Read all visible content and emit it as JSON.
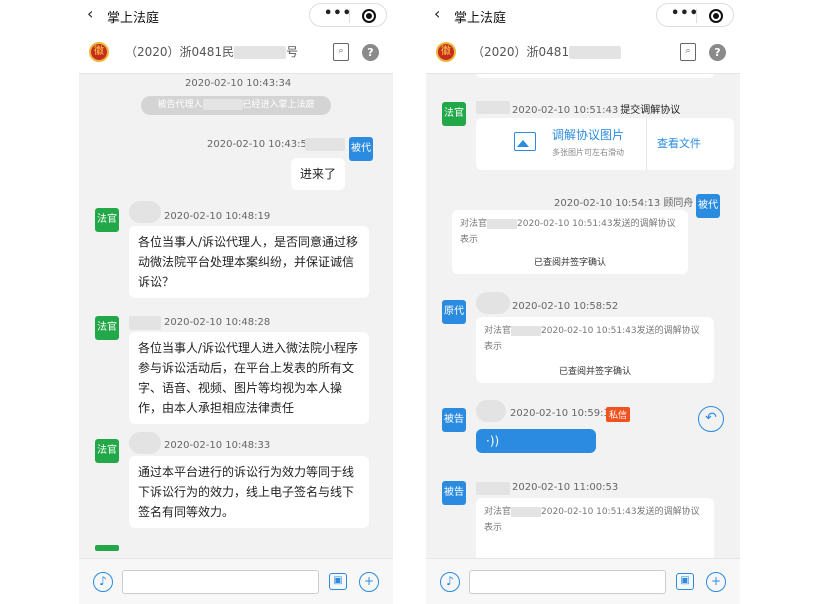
{
  "app": {
    "back_icon": "‹",
    "title": "掌上法庭",
    "menu_dots": "•••"
  },
  "case": {
    "number_prefix": "（2020）浙0481民",
    "number_suffix": "号",
    "number_prefix_right": "（2020）浙0481",
    "emblem": "徽",
    "doc_glyph": "⌕",
    "help_glyph": "?"
  },
  "left": {
    "time_join": "2020-02-10 10:43:34",
    "sys_pre": "被告代理人",
    "sys_post": "已经进入掌上法庭",
    "r1_time": "2020-02-10 10:43:52",
    "r1_role": "被代",
    "r1_text": "进来了",
    "m1_role": "法官",
    "m1_time": "2020-02-10 10:48:19",
    "m1_text": "各位当事人/诉讼代理人，是否同意通过移动微法院平台处理本案纠纷，并保证诚信诉讼？",
    "m2_role": "法官",
    "m2_time": "2020-02-10 10:48:28",
    "m2_text": "各位当事人/诉讼代理人进入微法院小程序参与诉讼活动后，在平台上发表的所有文字、语音、视频、图片等均视为本人操作，由本人承担相应法律责任",
    "m3_role": "法官",
    "m3_time": "2020-02-10 10:48:33",
    "m3_text": "通过本平台进行的诉讼行为效力等同于线下诉讼行为的效力，线上电子签名与线下签名有同等效力。"
  },
  "right": {
    "a_role": "法官",
    "a_time": "2020-02-10 10:51:43",
    "a_action": "提交调解协议",
    "doc_title": "调解协议图片",
    "doc_hint": "多张图片可左右滑动",
    "doc_view": "查看文件",
    "b_time": "2020-02-10 10:54:13 顾同舟",
    "b_role": "被代",
    "b_q1": "对法官",
    "b_q2": "2020-02-10 10:51:43发送的调解协议表示",
    "b_ok": "已查阅并签字确认",
    "c_role": "原代",
    "c_time": "2020-02-10 10:58:52",
    "c_q1": "对法官",
    "c_q2": "2020-02-10 10:51:43发送的调解协议表示",
    "c_ok": "已查阅并签字确认",
    "d_role": "被告",
    "d_time": "2020-02-10 10:59:33",
    "d_private": "私信",
    "d_voice": "·))",
    "d_reply": "↶",
    "e_role": "被告",
    "e_time": "2020-02-10 11:00:53",
    "e_q1": "对法官",
    "e_q2": "2020-02-10 10:51:43发送的调解协议表示"
  },
  "input": {
    "voice_glyph": "♪",
    "image_glyph": "▣",
    "plus_glyph": "+"
  },
  "colors": {
    "accent": "#2a8be0",
    "judge": "#22a848",
    "party": "#2a8be0",
    "private_badge": "#f0531f"
  }
}
